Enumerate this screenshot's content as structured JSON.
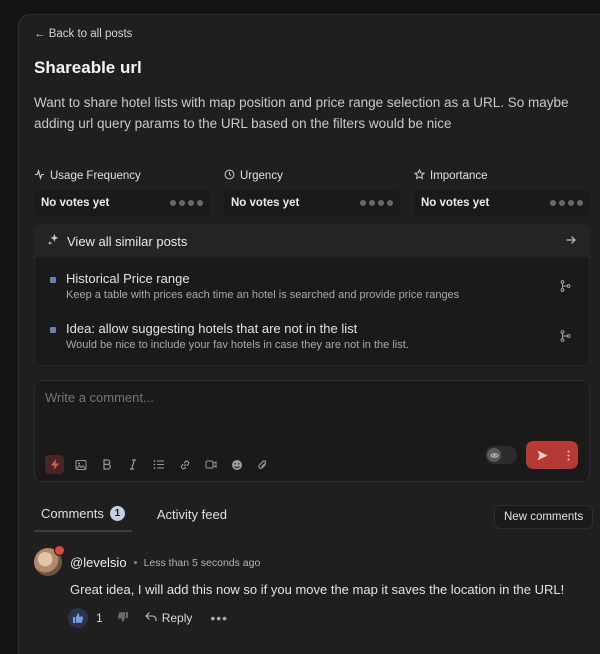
{
  "nav": {
    "back_label": "← Back to all posts"
  },
  "post": {
    "title": "Shareable url",
    "description": "Want to share hotel lists with map position and price range selection as a URL. So maybe adding url query params to the URL based on the filters would be nice"
  },
  "votes": [
    {
      "label": "Usage Frequency",
      "icon": "pulse-icon",
      "value": "No votes yet"
    },
    {
      "label": "Urgency",
      "icon": "clock-icon",
      "value": "No votes yet"
    },
    {
      "label": "Importance",
      "icon": "star-icon",
      "value": "No votes yet"
    }
  ],
  "similar": {
    "header": "View all similar posts",
    "items": [
      {
        "title": "Historical Price range",
        "subtitle": "Keep a table with prices each time an hotel is searched and provide price ranges"
      },
      {
        "title": "Idea: allow suggesting hotels that are not in the list",
        "subtitle": "Would be nice to include your fav hotels in case they are not in the list."
      }
    ]
  },
  "composer": {
    "placeholder": "Write a comment..."
  },
  "tabs": {
    "comments_label": "Comments",
    "comments_count": "1",
    "activity_label": "Activity feed",
    "new_comments_label": "New comments"
  },
  "comment": {
    "author": "@levelsio",
    "time": "Less than 5 seconds ago",
    "text": "Great idea, I will add this now so if you move the map it saves the location in the URL!",
    "likes": "1",
    "reply_label": "Reply"
  },
  "colors": {
    "accent": "#b43a34",
    "panel": "#1f1f1f",
    "background": "#141414"
  }
}
